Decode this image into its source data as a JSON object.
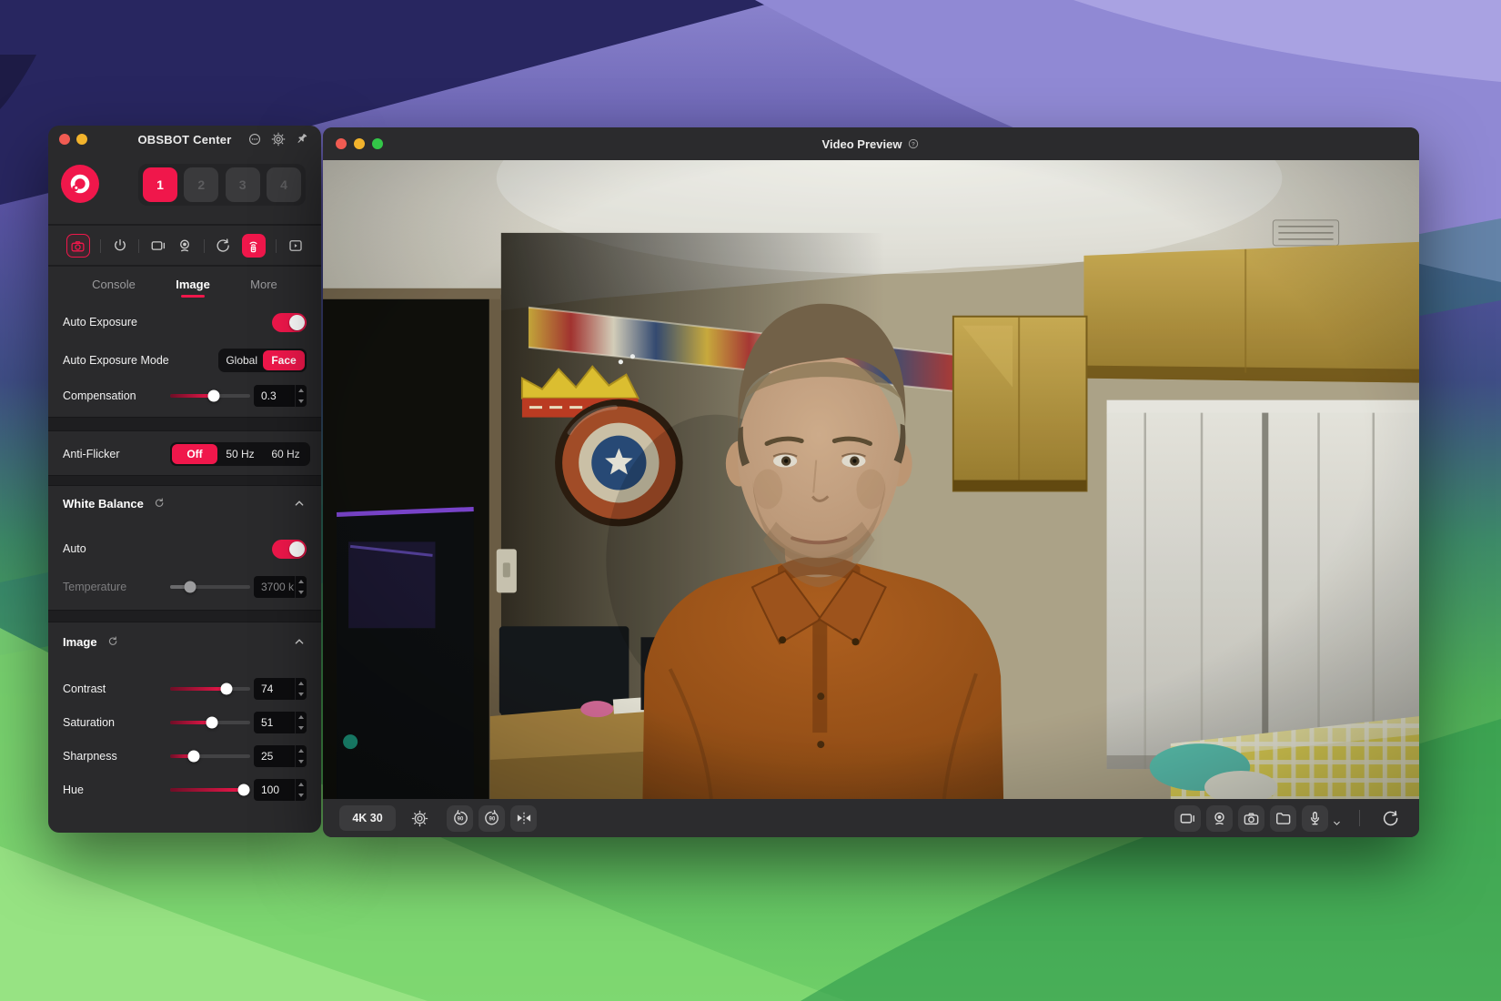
{
  "colors": {
    "accent": "#f0174b",
    "panel": "#2a2a2c",
    "titlebar": "#2b2b2d",
    "toggle_on": "#f0174b",
    "slider_fill_start": "#6e0e26",
    "slider_fill_end": "#f0174b",
    "wallpaper_green": "#55bd5f",
    "wallpaper_purple": "#5a54a8"
  },
  "obsbot": {
    "title": "OBSBOT Center",
    "titlebar_icons": [
      "circle-ellipsis",
      "gear",
      "pin"
    ],
    "presets": {
      "buttons": [
        "1",
        "2",
        "3",
        "4"
      ],
      "active_index": 0
    },
    "toolbar_icons": [
      "camera",
      "power",
      "display",
      "webcam",
      "rotate",
      "remote",
      "expand"
    ],
    "tabs": {
      "items": [
        "Console",
        "Image",
        "More"
      ],
      "active": "Image"
    },
    "auto_exposure": {
      "label": "Auto Exposure",
      "enabled": true
    },
    "ae_mode": {
      "label": "Auto Exposure Mode",
      "options": [
        "Global",
        "Face"
      ],
      "selected": "Face"
    },
    "compensation": {
      "label": "Compensation",
      "value": "0.3",
      "percent": 55
    },
    "anti_flicker": {
      "label": "Anti-Flicker",
      "options": [
        "Off",
        "50 Hz",
        "60 Hz"
      ],
      "selected": "Off"
    },
    "white_balance": {
      "title": "White Balance",
      "auto_label": "Auto",
      "auto_enabled": true,
      "temperature": {
        "label": "Temperature",
        "value": "3700 k",
        "percent": 25,
        "disabled": true
      }
    },
    "image_section": {
      "title": "Image",
      "sliders": [
        {
          "label": "Contrast",
          "value": "74",
          "percent": 70
        },
        {
          "label": "Saturation",
          "value": "51",
          "percent": 52
        },
        {
          "label": "Sharpness",
          "value": "25",
          "percent": 29
        },
        {
          "label": "Hue",
          "value": "100",
          "percent": 92
        }
      ]
    }
  },
  "preview": {
    "title": "Video Preview",
    "help_icon": "question-circle",
    "resolution_label": "4K 30",
    "left_control_icons": [
      "settings-gear",
      "rotate-ccw-90",
      "rotate-cw-90",
      "flip-horizontal"
    ],
    "right_control_icons": [
      "virtual-display",
      "webcam",
      "snapshot-camera",
      "folder",
      "microphone",
      "gimbal-refresh"
    ]
  }
}
